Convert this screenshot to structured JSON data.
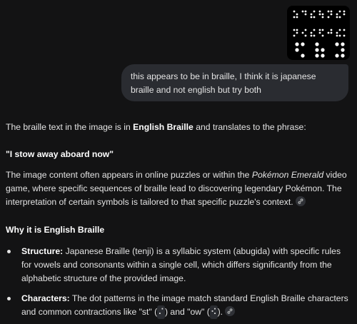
{
  "user_message": {
    "text": "this appears to be in braille, I think it is japanese braille and not english but try both"
  },
  "response": {
    "intro_prefix": "The braille text in the image is in ",
    "intro_bold": "English Braille",
    "intro_suffix": " and translates to the phrase:",
    "translation": "\"I stow away aboard now\"",
    "context_p1": "The image content often appears in online puzzles or within the ",
    "context_italic": "Pokémon Emerald",
    "context_p2": " video game, where specific sequences of braille lead to discovering legendary Pokémon. The interpretation of certain symbols is tailored to that specific puzzle's context.",
    "section_heading": "Why it is English Braille",
    "bullets": [
      {
        "label": "Structure:",
        "text": " Japanese Braille (tenji) is a syllabic system (abugida) with specific rules for vowels and consonants within a single cell, which differs significantly from the alphabetic structure of the provided image."
      },
      {
        "label": "Characters:",
        "text_a": " The dot patterns in the image match standard English Braille characters and common contractions like \"st\" (",
        "braille_st": "⠌",
        "text_b": ") and \"ow\" (",
        "braille_ow": "⠪",
        "text_c": ")."
      }
    ]
  },
  "icons": {
    "link_chip": "link-icon",
    "attachment": "braille-image"
  }
}
